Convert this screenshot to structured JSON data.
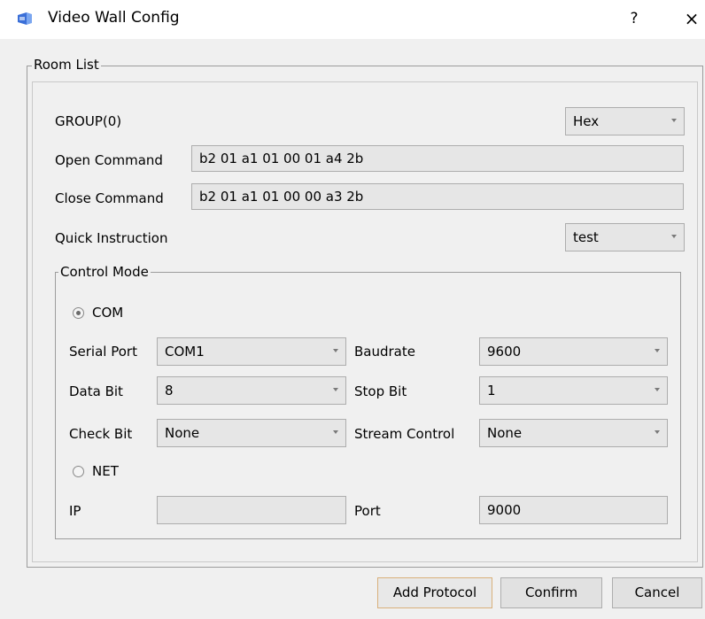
{
  "window": {
    "title": "Video Wall Config",
    "help_label": "?",
    "close_label": "×"
  },
  "room_list": {
    "legend": "Room List",
    "group_label": "GROUP(0)",
    "format_value": "Hex",
    "open_command_label": "Open Command",
    "open_command_value": "b2 01 a1 01 00 01 a4 2b",
    "close_command_label": "Close Command",
    "close_command_value": "b2 01 a1 01 00 00 a3 2b",
    "quick_instruction_label": "Quick Instruction",
    "quick_instruction_value": "test"
  },
  "control_mode": {
    "legend": "Control Mode",
    "com_label": "COM",
    "com_checked": true,
    "serial_port_label": "Serial Port",
    "serial_port_value": "COM1",
    "baudrate_label": "Baudrate",
    "baudrate_value": "9600",
    "data_bit_label": "Data Bit",
    "data_bit_value": "8",
    "stop_bit_label": "Stop Bit",
    "stop_bit_value": "1",
    "check_bit_label": "Check Bit",
    "check_bit_value": "None",
    "stream_control_label": "Stream Control",
    "stream_control_value": "None",
    "net_label": "NET",
    "net_checked": false,
    "ip_label": "IP",
    "ip_value": "",
    "port_label": "Port",
    "port_value": "9000"
  },
  "buttons": {
    "add_protocol": "Add Protocol",
    "confirm": "Confirm",
    "cancel": "Cancel"
  },
  "colors": {
    "field_bg": "#e6e6e6",
    "window_bg": "#f0f0f0",
    "default_button_border": "#d9b07a",
    "icon_blue": "#3a6fd8"
  }
}
